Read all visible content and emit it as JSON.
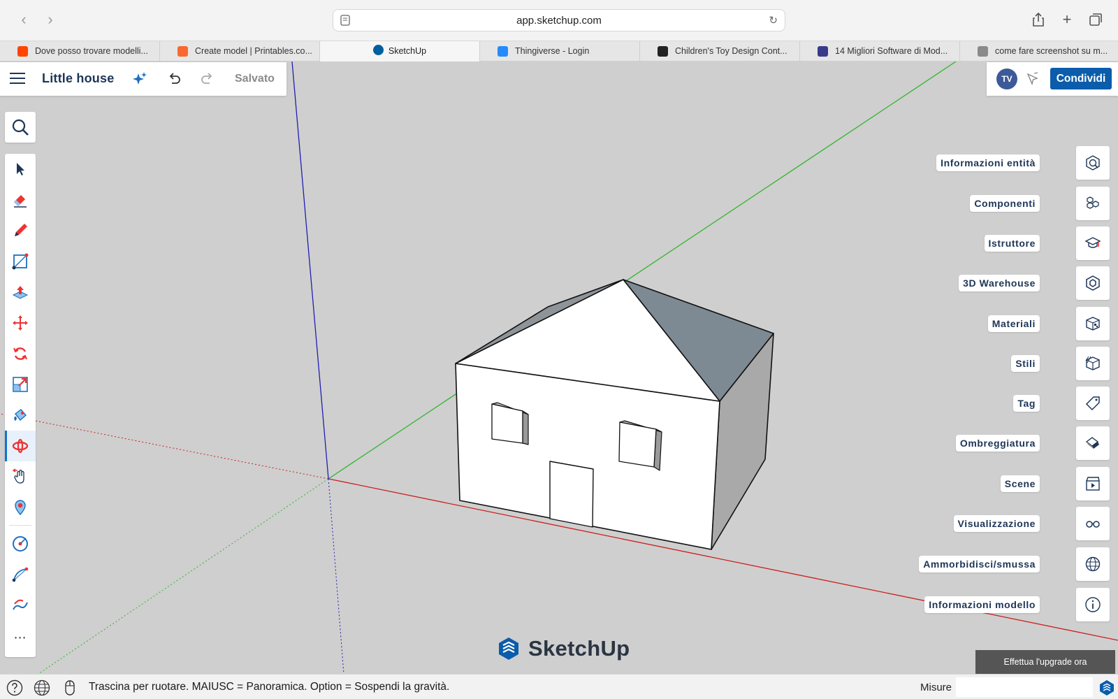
{
  "browser": {
    "url": "app.sketchup.com",
    "tabs": [
      {
        "label": "Dove posso trovare modelli...",
        "icon": "reddit-favicon",
        "color": "#ff4500"
      },
      {
        "label": "Create model | Printables.co...",
        "icon": "printables-favicon",
        "color": "#fa6831"
      },
      {
        "label": "SketchUp",
        "icon": "sketchup-favicon",
        "color": "#005f9e"
      },
      {
        "label": "Thingiverse - Login",
        "icon": "thingiverse-favicon",
        "color": "#248bfb"
      },
      {
        "label": "Children's Toy Design Cont...",
        "icon": "contest-favicon",
        "color": "#222222"
      },
      {
        "label": "14 Migliori Software di Mod...",
        "icon": "software-favicon",
        "color": "#3a3a8a"
      },
      {
        "label": "come fare screenshot su m...",
        "icon": "google-favicon",
        "color": "#8a8a8a"
      }
    ],
    "active_tab": 2
  },
  "model": {
    "title": "Little house",
    "saved_label": "Salvato"
  },
  "account": {
    "initials": "TV",
    "share_label": "Condividi"
  },
  "toolbar": {
    "tools": [
      "select-tool",
      "eraser-tool",
      "pencil-tool",
      "rectangle-tool",
      "push-pull-tool",
      "move-tool",
      "rotate-tool",
      "scale-tool",
      "paint-tool",
      "orbit-tool",
      "pan-tool",
      "position-camera-tool",
      "tape-measure-tool",
      "arc-tool",
      "freehand-tool"
    ],
    "active_tool": "orbit-tool",
    "more_label": "⋯"
  },
  "panels": [
    {
      "label": "Informazioni entità",
      "icon": "entity-info-icon"
    },
    {
      "label": "Componenti",
      "icon": "components-icon"
    },
    {
      "label": "Istruttore",
      "icon": "instructor-icon"
    },
    {
      "label": "3D Warehouse",
      "icon": "warehouse-icon"
    },
    {
      "label": "Materiali",
      "icon": "materials-icon"
    },
    {
      "label": "Stili",
      "icon": "styles-icon"
    },
    {
      "label": "Tag",
      "icon": "tag-icon"
    },
    {
      "label": "Ombreggiatura",
      "icon": "shadows-icon"
    },
    {
      "label": "Scene",
      "icon": "scenes-icon"
    },
    {
      "label": "Visualizzazione",
      "icon": "display-icon"
    },
    {
      "label": "Ammorbidisci/smussa",
      "icon": "soften-icon"
    },
    {
      "label": "Informazioni modello",
      "icon": "model-info-icon"
    }
  ],
  "brand": {
    "wordmark": "SketchUp",
    "accent": "#0b5cab"
  },
  "upgrade_label": "Effettua l'upgrade ora",
  "status": {
    "hint": "Trascina per ruotare. MAIUSC = Panoramica. Option = Sospendi la gravità.",
    "measure_label": "Misure",
    "measure_value": ""
  },
  "colors": {
    "axis_red": "#cc1f1f",
    "axis_green": "#2fb52f",
    "axis_blue": "#1f1fb0",
    "roof_shade": "#7d8a93",
    "wall_shade": "#a9a9a9"
  }
}
